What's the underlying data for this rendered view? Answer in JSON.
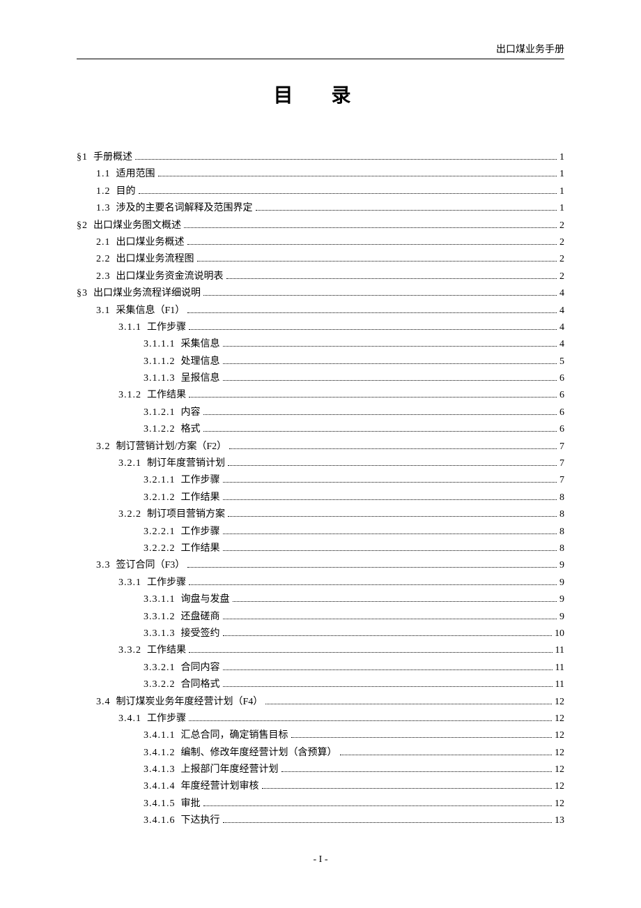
{
  "header": "出口煤业务手册",
  "title": "目  录",
  "footer": "- I -",
  "toc": [
    {
      "level": 1,
      "num": "§1",
      "label": "手册概述",
      "page": "1"
    },
    {
      "level": 2,
      "num": "1.1",
      "label": "适用范围",
      "page": "1"
    },
    {
      "level": 2,
      "num": "1.2",
      "label": "目的",
      "page": "1"
    },
    {
      "level": 2,
      "num": "1.3",
      "label": "涉及的主要名词解释及范围界定",
      "page": "1"
    },
    {
      "level": 1,
      "num": "§2",
      "label": "出口煤业务图文概述",
      "page": "2"
    },
    {
      "level": 2,
      "num": "2.1",
      "label": "出口煤业务概述",
      "page": "2"
    },
    {
      "level": 2,
      "num": "2.2",
      "label": "出口煤业务流程图",
      "page": "2"
    },
    {
      "level": 2,
      "num": "2.3",
      "label": "出口煤业务资金流说明表",
      "page": "2"
    },
    {
      "level": 1,
      "num": "§3",
      "label": "出口煤业务流程详细说明",
      "page": "4"
    },
    {
      "level": 2,
      "num": "3.1",
      "label": "采集信息（F1）",
      "page": "4"
    },
    {
      "level": 3,
      "num": "3.1.1",
      "label": "工作步骤",
      "page": "4"
    },
    {
      "level": 4,
      "num": "3.1.1.1",
      "label": "采集信息",
      "page": "4"
    },
    {
      "level": 4,
      "num": "3.1.1.2",
      "label": "处理信息",
      "page": "5"
    },
    {
      "level": 4,
      "num": "3.1.1.3",
      "label": "呈报信息",
      "page": "6"
    },
    {
      "level": 3,
      "num": "3.1.2",
      "label": "工作结果",
      "page": "6"
    },
    {
      "level": 4,
      "num": "3.1.2.1",
      "label": "内容",
      "page": "6"
    },
    {
      "level": 4,
      "num": "3.1.2.2",
      "label": "格式",
      "page": "6"
    },
    {
      "level": 2,
      "num": "3.2",
      "label": "制订营销计划/方案（F2）",
      "page": "7"
    },
    {
      "level": 3,
      "num": "3.2.1",
      "label": "制订年度营销计划",
      "page": "7"
    },
    {
      "level": 4,
      "num": "3.2.1.1",
      "label": "工作步骤",
      "page": "7"
    },
    {
      "level": 4,
      "num": "3.2.1.2",
      "label": "工作结果",
      "page": "8"
    },
    {
      "level": 3,
      "num": "3.2.2",
      "label": "制订项目营销方案",
      "page": "8"
    },
    {
      "level": 4,
      "num": "3.2.2.1",
      "label": "工作步骤",
      "page": "8"
    },
    {
      "level": 4,
      "num": "3.2.2.2",
      "label": "工作结果",
      "page": "8"
    },
    {
      "level": 2,
      "num": "3.3",
      "label": "签订合同（F3）",
      "page": "9"
    },
    {
      "level": 3,
      "num": "3.3.1",
      "label": "工作步骤",
      "page": "9"
    },
    {
      "level": 4,
      "num": "3.3.1.1",
      "label": "询盘与发盘",
      "page": "9"
    },
    {
      "level": 4,
      "num": "3.3.1.2",
      "label": "还盘磋商",
      "page": "9"
    },
    {
      "level": 4,
      "num": "3.3.1.3",
      "label": "接受签约",
      "page": "10"
    },
    {
      "level": 3,
      "num": "3.3.2",
      "label": "工作结果",
      "page": "11"
    },
    {
      "level": 4,
      "num": "3.3.2.1",
      "label": "合同内容",
      "page": "11"
    },
    {
      "level": 4,
      "num": "3.3.2.2",
      "label": "合同格式",
      "page": "11"
    },
    {
      "level": 2,
      "num": "3.4",
      "label": "制订煤炭业务年度经营计划（F4）",
      "page": "12"
    },
    {
      "level": 3,
      "num": "3.4.1",
      "label": "工作步骤",
      "page": "12"
    },
    {
      "level": 4,
      "num": "3.4.1.1",
      "label": "汇总合同，确定销售目标",
      "page": "12"
    },
    {
      "level": 4,
      "num": "3.4.1.2",
      "label": "编制、修改年度经营计划（含预算）",
      "page": "12"
    },
    {
      "level": 4,
      "num": "3.4.1.3",
      "label": "上报部门年度经营计划",
      "page": "12"
    },
    {
      "level": 4,
      "num": "3.4.1.4",
      "label": "年度经营计划审核",
      "page": "12"
    },
    {
      "level": 4,
      "num": "3.4.1.5",
      "label": "审批",
      "page": "12"
    },
    {
      "level": 4,
      "num": "3.4.1.6",
      "label": "下达执行",
      "page": "13"
    }
  ]
}
